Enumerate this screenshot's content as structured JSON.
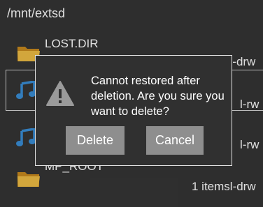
{
  "path": "/mnt/extsd",
  "files": [
    {
      "name": "LOST.DIR",
      "meta": "sl-drw",
      "icon": "folder-icon"
    },
    {
      "name": "",
      "meta": "l-rw",
      "icon": "music-note-icon"
    },
    {
      "name": "",
      "meta": "l-rw",
      "icon": "music-note-icon"
    },
    {
      "name": "MP_ROOT",
      "meta": "1 itemsl-drw",
      "icon": "folder-icon"
    }
  ],
  "dialog": {
    "icon": "warning-icon",
    "message": "Cannot restored after deletion. Are you sure you want to delete?",
    "delete_label": "Delete",
    "cancel_label": "Cancel"
  },
  "colors": {
    "background": "#353535",
    "dialog_background": "#303030",
    "button": "#8e8e8e",
    "folder": "#e8b23c",
    "music": "#3a8fd8",
    "warning": "#9a9a9a"
  }
}
